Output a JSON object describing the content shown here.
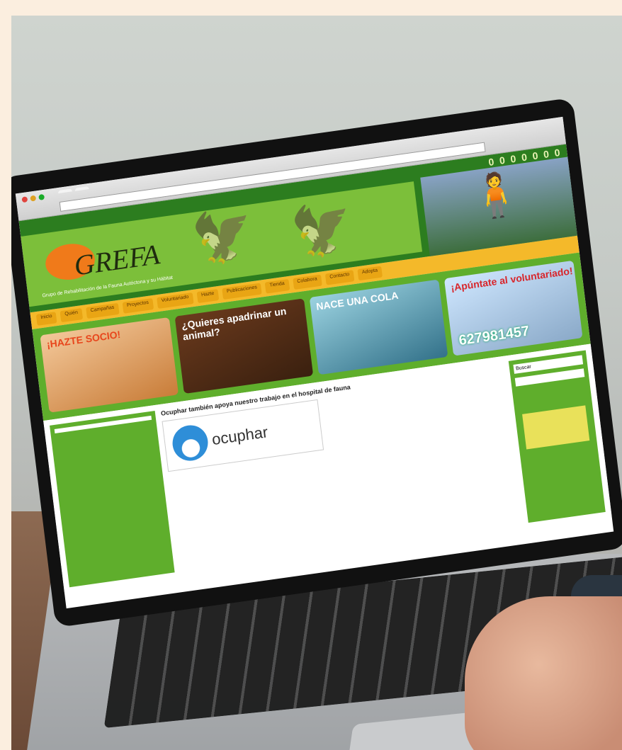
{
  "browser": {
    "tabs": [
      "",
      ""
    ],
    "url": ""
  },
  "site": {
    "counter": "0 0 0 0 0 0 0",
    "logo": "GREFA",
    "tagline": "Grupo de Rehabilitación de la Fauna Autóctona y su Hábitat",
    "nav": [
      "Inicio",
      "Quién",
      "Campañas",
      "Proyectos",
      "Voluntariado",
      "Hazte",
      "Publicaciones",
      "Tienda",
      "Colabora",
      "Contacto",
      "Adopta"
    ],
    "promos": [
      {
        "title": "¡HAZTE SOCIO!"
      },
      {
        "title": "¿Quieres apadrinar un animal?"
      },
      {
        "title": "NACE UNA COLA"
      },
      {
        "title": "¡Apúntate al voluntariado!",
        "number": "627981457"
      }
    ],
    "headline": "Ocuphar también apoya nuestro trabajo en el hospital de fauna",
    "sponsor": "ocuphar",
    "search_label": "Buscar"
  },
  "colors": {
    "green": "#5fae2c",
    "dark_green": "#2c7d1f",
    "orange": "#f07a1a",
    "yellow": "#f4b92a"
  }
}
